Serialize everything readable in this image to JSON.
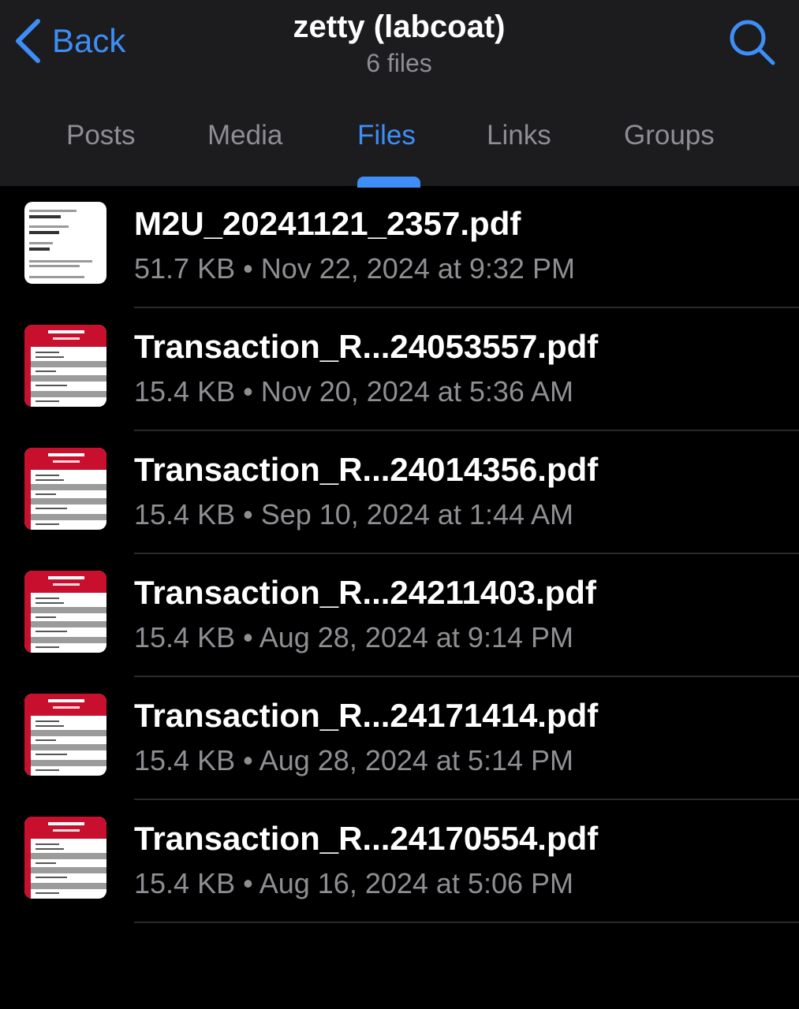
{
  "header": {
    "back_label": "Back",
    "title": "zetty (labcoat)",
    "subtitle": "6 files",
    "accent_color": "#3d8ef7",
    "back_icon": "chevron-left-icon",
    "search_icon": "search-icon"
  },
  "tabs": [
    {
      "label": "Posts",
      "active": false
    },
    {
      "label": "Media",
      "active": false
    },
    {
      "label": "Files",
      "active": true
    },
    {
      "label": "Links",
      "active": false
    },
    {
      "label": "Groups",
      "active": false
    }
  ],
  "files": [
    {
      "name": "M2U_20241121_2357.pdf",
      "size": "51.7 KB",
      "date": "Nov 22, 2024 at 9:32 PM",
      "meta": "51.7 KB • Nov 22, 2024 at 9:32 PM",
      "thumb": "m2u-receipt"
    },
    {
      "name": "Transaction_R...24053557.pdf",
      "size": "15.4 KB",
      "date": "Nov 20, 2024 at 5:36 AM",
      "meta": "15.4 KB • Nov 20, 2024 at 5:36 AM",
      "thumb": "bankislam-receipt"
    },
    {
      "name": "Transaction_R...24014356.pdf",
      "size": "15.4 KB",
      "date": "Sep 10, 2024 at 1:44 AM",
      "meta": "15.4 KB • Sep 10, 2024 at 1:44 AM",
      "thumb": "bankislam-receipt"
    },
    {
      "name": "Transaction_R...24211403.pdf",
      "size": "15.4 KB",
      "date": "Aug 28, 2024 at 9:14 PM",
      "meta": "15.4 KB • Aug 28, 2024 at 9:14 PM",
      "thumb": "bankislam-receipt"
    },
    {
      "name": "Transaction_R...24171414.pdf",
      "size": "15.4 KB",
      "date": "Aug 28, 2024 at 5:14 PM",
      "meta": "15.4 KB • Aug 28, 2024 at 5:14 PM",
      "thumb": "bankislam-receipt"
    },
    {
      "name": "Transaction_R...24170554.pdf",
      "size": "15.4 KB",
      "date": "Aug 16, 2024 at 5:06 PM",
      "meta": "15.4 KB • Aug 16, 2024 at 5:06 PM",
      "thumb": "bankislam-receipt"
    }
  ]
}
